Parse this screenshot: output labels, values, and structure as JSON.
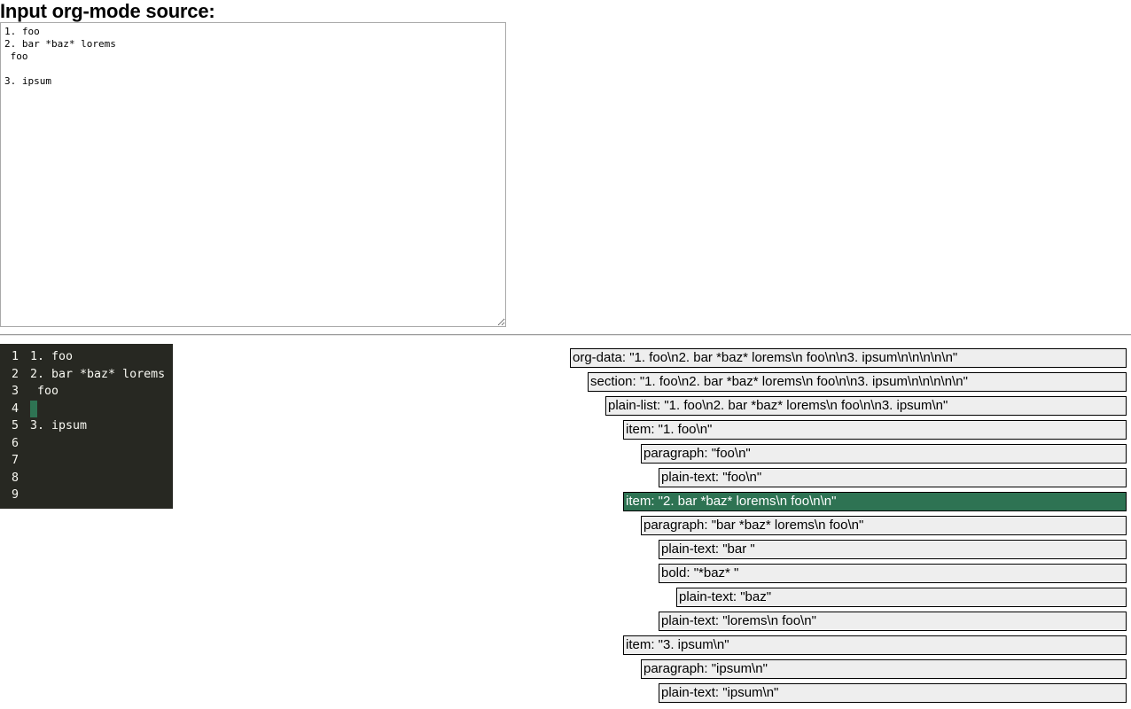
{
  "page": {
    "heading": "Input org-mode source:"
  },
  "source": {
    "text": "1. foo\n2. bar *baz* lorems\n foo\n\n3. ipsum"
  },
  "code_view": {
    "lines": [
      {
        "n": "1",
        "text": "1. foo",
        "highlighted": false
      },
      {
        "n": "2",
        "text": "2. bar *baz* lorems",
        "highlighted": true
      },
      {
        "n": "3",
        "text": " foo",
        "highlighted": true
      },
      {
        "n": "4",
        "text": "",
        "highlighted": true
      },
      {
        "n": "5",
        "text": "3. ipsum",
        "highlighted": false
      },
      {
        "n": "6",
        "text": "",
        "highlighted": false
      },
      {
        "n": "7",
        "text": "",
        "highlighted": false
      },
      {
        "n": "8",
        "text": "",
        "highlighted": false
      },
      {
        "n": "9",
        "text": "",
        "highlighted": false
      }
    ]
  },
  "tree": [
    {
      "label": "org-data: \"1. foo\\n2. bar *baz* lorems\\n foo\\n\\n3. ipsum\\n\\n\\n\\n\\n\"",
      "depth": 0,
      "active": false
    },
    {
      "label": "section: \"1. foo\\n2. bar *baz* lorems\\n foo\\n\\n3. ipsum\\n\\n\\n\\n\\n\"",
      "depth": 1,
      "active": false
    },
    {
      "label": "plain-list: \"1. foo\\n2. bar *baz* lorems\\n foo\\n\\n3. ipsum\\n\"",
      "depth": 2,
      "active": false
    },
    {
      "label": "item: \"1. foo\\n\"",
      "depth": 3,
      "active": false
    },
    {
      "label": "paragraph: \"foo\\n\"",
      "depth": 4,
      "active": false
    },
    {
      "label": "plain-text: \"foo\\n\"",
      "depth": 5,
      "active": false
    },
    {
      "label": "item: \"2. bar *baz* lorems\\n foo\\n\\n\"",
      "depth": 3,
      "active": true
    },
    {
      "label": "paragraph: \"bar *baz* lorems\\n foo\\n\"",
      "depth": 4,
      "active": false
    },
    {
      "label": "plain-text: \"bar \"",
      "depth": 5,
      "active": false
    },
    {
      "label": "bold: \"*baz* \"",
      "depth": 5,
      "active": false
    },
    {
      "label": "plain-text: \"baz\"",
      "depth": 6,
      "active": false
    },
    {
      "label": "plain-text: \"lorems\\n foo\\n\"",
      "depth": 5,
      "active": false
    },
    {
      "label": "item: \"3. ipsum\\n\"",
      "depth": 3,
      "active": false
    },
    {
      "label": "paragraph: \"ipsum\\n\"",
      "depth": 4,
      "active": false
    },
    {
      "label": "plain-text: \"ipsum\\n\"",
      "depth": 5,
      "active": false
    }
  ],
  "colors": {
    "highlight": "#2e7353",
    "code_background": "#272822",
    "node_background": "#eeeeee"
  }
}
